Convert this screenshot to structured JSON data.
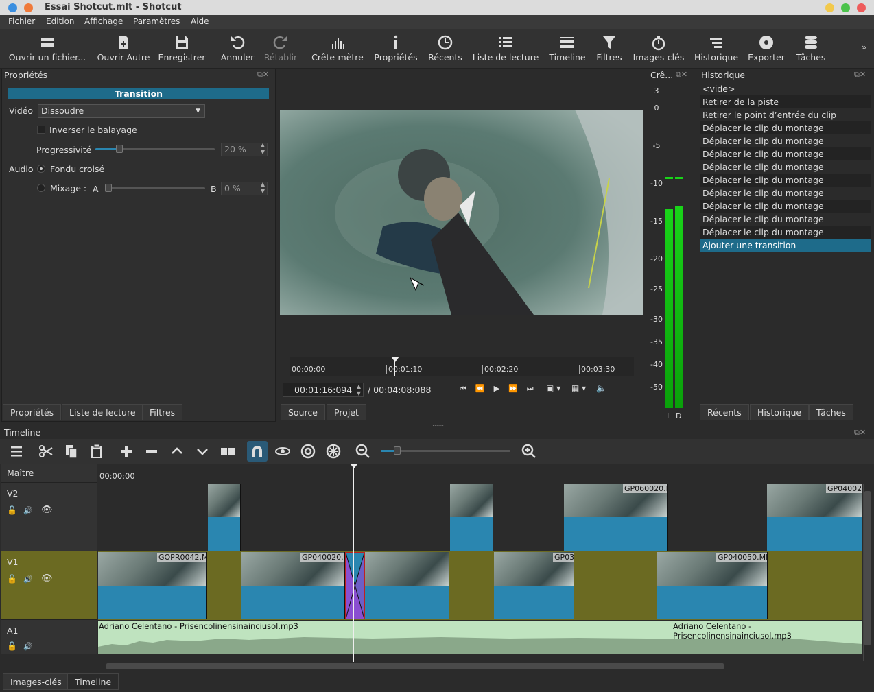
{
  "window": {
    "title": "Essai Shotcut.mlt - Shotcut"
  },
  "menu": [
    "Fichier",
    "Edition",
    "Affichage",
    "Paramètres",
    "Aide"
  ],
  "toolbar": {
    "open_file": "Ouvrir un fichier...",
    "open_other": "Ouvrir Autre",
    "save": "Enregistrer",
    "undo": "Annuler",
    "redo": "Rétablir",
    "peak_meter": "Crête-mètre",
    "properties": "Propriétés",
    "recent": "Récents",
    "playlist": "Liste de lecture",
    "timeline": "Timeline",
    "filters": "Filtres",
    "keyframes": "Images-clés",
    "history": "Historique",
    "export": "Exporter",
    "jobs": "Tâches",
    "more": "»"
  },
  "properties_panel": {
    "title": "Propriétés",
    "section": "Transition",
    "video_label": "Vidéo",
    "video_value": "Dissoudre",
    "invert_label": "Inverser le balayage",
    "softness_label": "Progressivité",
    "softness_value": "20 %",
    "softness_level": 0.2,
    "audio_label": "Audio",
    "crossfade_label": "Fondu croisé",
    "mix_label": "Mixage :",
    "mix_a": "A",
    "mix_b": "B",
    "mix_value": "0 %",
    "mix_level": 0.0,
    "tabs": [
      "Propriétés",
      "Liste de lecture",
      "Filtres"
    ]
  },
  "player": {
    "ruler": [
      "00:00:00",
      "00:01:10",
      "00:02:20",
      "00:03:30"
    ],
    "position": "00:01:16:094",
    "duration": "/ 00:04:08:088",
    "tabs": [
      "Source",
      "Projet"
    ]
  },
  "meter": {
    "title": "Crê...",
    "scale": [
      "3",
      "0",
      "-5",
      "-10",
      "-15",
      "-20",
      "-25",
      "-30",
      "-35",
      "-40",
      "-50"
    ],
    "channels": [
      "L",
      "D"
    ]
  },
  "history": {
    "title": "Historique",
    "items": [
      "<vide>",
      "Retirer de la piste",
      "Retirer le point d’entrée du clip",
      "Déplacer le clip du montage",
      "Déplacer le clip du montage",
      "Déplacer le clip du montage",
      "Déplacer le clip du montage",
      "Déplacer le clip du montage",
      "Déplacer le clip du montage",
      "Déplacer le clip du montage",
      "Déplacer le clip du montage",
      "Déplacer le clip du montage",
      "Ajouter une transition"
    ],
    "tabs": [
      "Récents",
      "Historique",
      "Tâches"
    ]
  },
  "timeline": {
    "title": "Timeline",
    "master": "Maître",
    "time_start": "00:00:00",
    "tracks": [
      "V2",
      "V1",
      "A1"
    ],
    "clips_v1": [
      "GOPR0042.M",
      "GP040020.I",
      "GP03",
      "GP040050.MI"
    ],
    "clips_v2": [
      "GP060020.I",
      "GP04002"
    ],
    "audio_clip": "Adriano Celentano - Prisencolinensinainciusol.mp3",
    "tabs": [
      "Images-clés",
      "Timeline"
    ]
  },
  "colors": {
    "accent": "#1e6b8a",
    "v1_bg": "#6b6a22",
    "audio": "#2a86b0",
    "audio_wave": "#bfe3bf"
  }
}
